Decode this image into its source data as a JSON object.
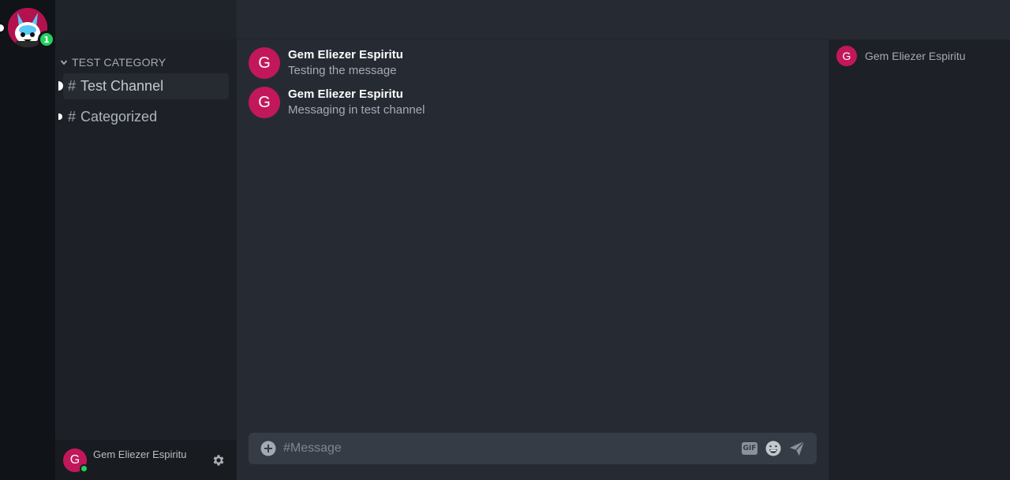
{
  "server_rail": {
    "servers": [
      {
        "icon": "mascot-avatar-icon",
        "badge": "1"
      }
    ]
  },
  "sidebar": {
    "category": "TEST CATEGORY",
    "channels": [
      {
        "hash": "#",
        "name": "Test Channel",
        "active": true
      },
      {
        "hash": "#",
        "name": "Categorized",
        "active": false
      }
    ]
  },
  "user_panel": {
    "avatar_initial": "G",
    "username": "Gem Eliezer Espiritu",
    "status": "online"
  },
  "messages": [
    {
      "avatar_initial": "G",
      "author": "Gem Eliezer Espiritu",
      "text": "Testing the message"
    },
    {
      "avatar_initial": "G",
      "author": "Gem Eliezer Espiritu",
      "text": "Messaging in test channel"
    }
  ],
  "composer": {
    "placeholder": "#Message",
    "value": "",
    "gif_label": "GIF"
  },
  "members": [
    {
      "avatar_initial": "G",
      "name": "Gem Eliezer Espiritu"
    }
  ],
  "colors": {
    "accent": "#c2185b",
    "online": "#23d160",
    "rail_bg": "#101317",
    "sidebar_bg": "#1d2127",
    "main_bg": "#262b33"
  }
}
